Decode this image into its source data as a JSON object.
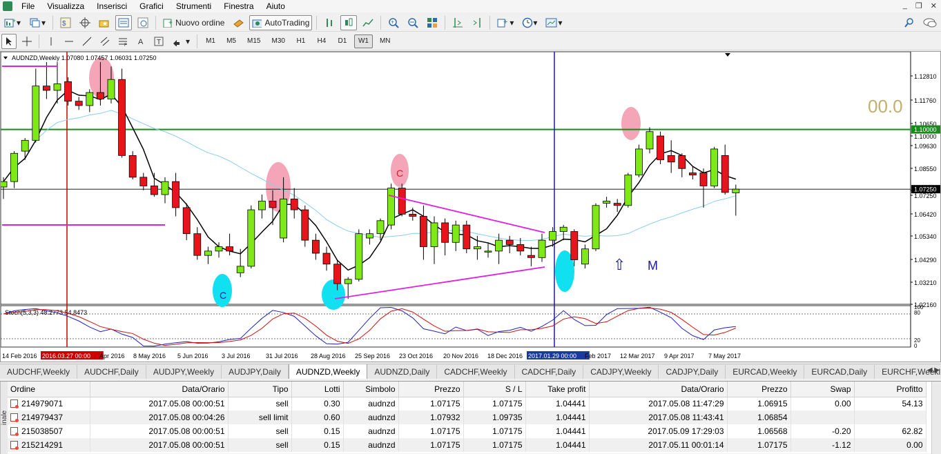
{
  "menu": {
    "items": [
      "File",
      "Visualizza",
      "Inserisci",
      "Grafici",
      "Strumenti",
      "Finestra",
      "Aiuto"
    ]
  },
  "toolbar": {
    "new_order_label": "Nuovo ordine",
    "autotrading_label": "AutoTrading"
  },
  "timeframes": [
    "M1",
    "M5",
    "M15",
    "M30",
    "H1",
    "H4",
    "D1",
    "W1",
    "MN"
  ],
  "active_timeframe": "W1",
  "chart": {
    "info": "AUDNZD,Weekly  1.07080 1.07457 1.06031 1.07250",
    "big_value": "00.0",
    "stoch_label": "Stoch(5,3,3) 48.2773 54.8473",
    "date_labels": [
      "14 Feb 2016",
      "2016.03.27 00:00",
      "Apr 2016",
      "8 May 2016",
      "5 Jun 2016",
      "3 Jul 2016",
      "31 Jul 2016",
      "28 Aug 2016",
      "25 Sep 2016",
      "23 Oct 2016",
      "20 Nov 2016",
      "18 Dec 2016",
      "2017.01.29 00:00",
      "Feb 2017",
      "12 Mar 2017",
      "9 Apr 2017",
      "7 May 2017"
    ],
    "price_labels": [
      "1.12810",
      "1.11760",
      "1.10650",
      "1.10000",
      "1.09630",
      "1.08550",
      "1.07470",
      "1.07250",
      "1.06420",
      "1.05340",
      "1.04290",
      "1.03210",
      "1.02160"
    ],
    "stoch_levels": [
      "100",
      "80",
      "20",
      "0"
    ],
    "annotations": {
      "c1": "C",
      "c2": "C",
      "m": "M",
      "arrow": "⇧"
    },
    "colors": {
      "bull": "#7fe817",
      "bear": "#e8141c",
      "ma_black": "#000000",
      "ma_blue": "#87ceeb",
      "hline": "#1a8a1a",
      "magenta": "#e020e0",
      "vline_red": "#cc0000",
      "vline_blue": "#1a1aa0",
      "pink": "#f4a6b8",
      "cyan": "#10e0f0"
    }
  },
  "chart_data": {
    "type": "candlestick",
    "symbol": "AUDNZD",
    "timeframe": "Weekly",
    "ylim": [
      1.0195,
      1.1345
    ],
    "ohlc": [
      [
        1.0735,
        1.078,
        1.068,
        1.076
      ],
      [
        1.076,
        1.09,
        1.073,
        1.089
      ],
      [
        1.09,
        1.096,
        1.086,
        1.095
      ],
      [
        1.095,
        1.128,
        1.094,
        1.12
      ],
      [
        1.12,
        1.131,
        1.114,
        1.118
      ],
      [
        1.118,
        1.131,
        1.112,
        1.121
      ],
      [
        1.122,
        1.124,
        1.111,
        1.113
      ],
      [
        1.113,
        1.115,
        1.109,
        1.111
      ],
      [
        1.111,
        1.1185,
        1.108,
        1.117
      ],
      [
        1.117,
        1.131,
        1.111,
        1.114
      ],
      [
        1.114,
        1.129,
        1.112,
        1.123
      ],
      [
        1.123,
        1.128,
        1.087,
        1.088
      ],
      [
        1.088,
        1.09,
        1.077,
        1.078
      ],
      [
        1.078,
        1.08,
        1.072,
        1.074
      ],
      [
        1.074,
        1.08,
        1.069,
        1.07
      ],
      [
        1.07,
        1.078,
        1.066,
        1.076
      ],
      [
        1.076,
        1.08,
        1.06,
        1.064
      ],
      [
        1.064,
        1.066,
        1.049,
        1.052
      ],
      [
        1.052,
        1.055,
        1.04,
        1.042
      ],
      [
        1.042,
        1.046,
        1.038,
        1.044
      ],
      [
        1.044,
        1.048,
        1.041,
        1.046
      ],
      [
        1.046,
        1.052,
        1.042,
        1.044
      ],
      [
        1.034,
        1.045,
        1.032,
        1.037
      ],
      [
        1.037,
        1.065,
        1.036,
        1.063
      ],
      [
        1.063,
        1.07,
        1.059,
        1.067
      ],
      [
        1.067,
        1.072,
        1.056,
        1.064
      ],
      [
        1.05,
        1.078,
        1.048,
        1.068
      ],
      [
        1.068,
        1.073,
        1.059,
        1.063
      ],
      [
        1.063,
        1.065,
        1.046,
        1.049
      ],
      [
        1.049,
        1.052,
        1.04,
        1.043
      ],
      [
        1.043,
        1.046,
        1.035,
        1.038
      ],
      [
        1.038,
        1.04,
        1.026,
        1.029
      ],
      [
        1.029,
        1.032,
        1.022,
        1.031
      ],
      [
        1.031,
        1.054,
        1.03,
        1.052
      ],
      [
        1.05,
        1.054,
        1.047,
        1.052
      ],
      [
        1.052,
        1.059,
        1.049,
        1.058
      ],
      [
        1.056,
        1.075,
        1.054,
        1.073
      ],
      [
        1.073,
        1.075,
        1.06,
        1.061
      ],
      [
        1.061,
        1.064,
        1.058,
        1.06
      ],
      [
        1.06,
        1.065,
        1.04,
        1.046
      ],
      [
        1.046,
        1.06,
        1.038,
        1.057
      ],
      [
        1.057,
        1.059,
        1.042,
        1.048
      ],
      [
        1.048,
        1.058,
        1.044,
        1.056
      ],
      [
        1.056,
        1.058,
        1.043,
        1.045
      ],
      [
        1.045,
        1.051,
        1.04,
        1.046
      ],
      [
        1.044,
        1.048,
        1.041,
        1.044
      ],
      [
        1.044,
        1.052,
        1.038,
        1.049
      ],
      [
        1.049,
        1.051,
        1.043,
        1.047
      ],
      [
        1.047,
        1.05,
        1.042,
        1.044
      ],
      [
        1.042,
        1.046,
        1.037,
        1.041
      ],
      [
        1.041,
        1.052,
        1.039,
        1.049
      ],
      [
        1.049,
        1.055,
        1.046,
        1.053
      ],
      [
        1.053,
        1.056,
        1.049,
        1.055
      ],
      [
        1.053,
        1.054,
        1.037,
        1.04
      ],
      [
        1.038,
        1.047,
        1.036,
        1.045
      ],
      [
        1.045,
        1.066,
        1.044,
        1.065
      ],
      [
        1.066,
        1.069,
        1.064,
        1.067
      ],
      [
        1.066,
        1.068,
        1.062,
        1.065
      ],
      [
        1.065,
        1.08,
        1.064,
        1.079
      ],
      [
        1.079,
        1.093,
        1.078,
        1.091
      ],
      [
        1.091,
        1.101,
        1.089,
        1.099
      ],
      [
        1.097,
        1.099,
        1.084,
        1.086
      ],
      [
        1.088,
        1.095,
        1.08,
        1.085
      ],
      [
        1.088,
        1.089,
        1.078,
        1.082
      ],
      [
        1.08,
        1.083,
        1.077,
        1.079
      ],
      [
        1.08,
        1.082,
        1.064,
        1.074
      ],
      [
        1.074,
        1.092,
        1.073,
        1.091
      ],
      [
        1.088,
        1.093,
        1.07,
        1.071
      ],
      [
        1.0708,
        1.0746,
        1.0603,
        1.0725
      ]
    ],
    "current_price": 1.0725,
    "level": 1.1,
    "stochastic": {
      "k": 48.2773,
      "d": 54.8473,
      "levels": [
        20,
        80
      ]
    }
  },
  "tabs": [
    "AUDCHF,Weekly",
    "AUDCHF,Daily",
    "AUDJPY,Weekly",
    "AUDJPY,Daily",
    "AUDNZD,Weekly",
    "AUDNZD,Daily",
    "CADCHF,Weekly",
    "CADCHF,Daily",
    "CADJPY,Weekly",
    "CADJPY,Daily",
    "EURCAD,Weekly",
    "EURCAD,Daily",
    "EURCHF,Weekl"
  ],
  "active_tab": "AUDNZD,Weekly",
  "terminal": {
    "side_label": "inale",
    "columns": [
      "Ordine",
      "Data/Orario",
      "Tipo",
      "Lotti",
      "Simbolo",
      "Prezzo",
      "S / L",
      "Take profit",
      "Data/Orario",
      "Prezzo",
      "Swap",
      "Profitto"
    ],
    "rows": [
      [
        "214979071",
        "2017.05.08 00:00:51",
        "sell",
        "0.30",
        "audnzd",
        "1.07175",
        "1.07175",
        "1.04441",
        "2017.05.08 11:47:29",
        "1.06915",
        "0.00",
        "54.13"
      ],
      [
        "214979437",
        "2017.05.08 00:04:26",
        "sell limit",
        "0.60",
        "audnzd",
        "1.07932",
        "1.09735",
        "1.04441",
        "2017.05.08 11:43:41",
        "1.06854",
        "",
        ""
      ],
      [
        "215038507",
        "2017.05.08 00:00:51",
        "sell",
        "0.15",
        "audnzd",
        "1.07175",
        "1.07175",
        "1.04441",
        "2017.05.09 17:29:03",
        "1.06568",
        "-0.20",
        "62.82"
      ],
      [
        "215214291",
        "2017.05.08 00:00:51",
        "sell",
        "0.15",
        "audnzd",
        "1.07175",
        "1.07175",
        "1.04441",
        "2017.05.11 00:01:14",
        "1.07175",
        "-1.12",
        "0.00"
      ]
    ]
  }
}
